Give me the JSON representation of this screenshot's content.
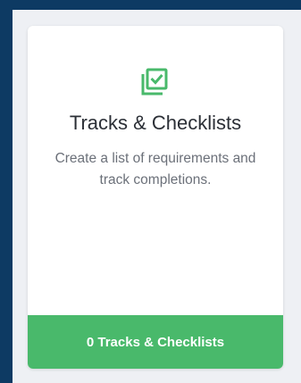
{
  "card": {
    "icon": "checklist-icon",
    "title": "Tracks & Checklists",
    "description": "Create a list of requirements and track completions.",
    "button_label": "0 Tracks & Checklists"
  },
  "colors": {
    "page_background": "#0d3a63",
    "panel_background": "#eef0f4",
    "card_background": "#ffffff",
    "accent_green": "#49b96b",
    "title_text": "#2b2f36",
    "description_text": "#6b7079"
  }
}
